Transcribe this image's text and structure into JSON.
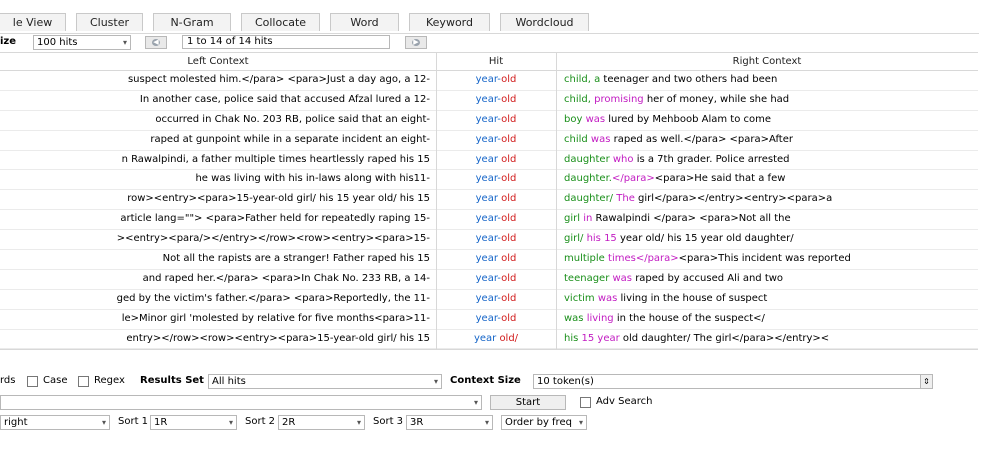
{
  "tabs": [
    "le View",
    "Cluster",
    "N-Gram",
    "Collocate",
    "Word",
    "Keyword",
    "Wordcloud"
  ],
  "pager": {
    "size_label": "ize",
    "hits_per_page": "100 hits",
    "range": "1 to 14 of 14 hits"
  },
  "table": {
    "headers": [
      "Left Context",
      "Hit",
      "Right Context"
    ],
    "rows": [
      {
        "left": "suspect molested him.</para> <para>Just a day ago, a 12-",
        "hit": [
          "year-old"
        ],
        "right": [
          [
            "child, a",
            "g1"
          ],
          [
            " teenager and two others had been",
            "n"
          ]
        ]
      },
      {
        "left": "In another case, police said that accused Afzal lured a 12-",
        "hit": [
          "year-old"
        ],
        "right": [
          [
            "child,",
            "g1"
          ],
          [
            " promising",
            "g2"
          ],
          [
            " her of money, while she had",
            "n"
          ]
        ]
      },
      {
        "left": "occurred in Chak No. 203 RB, police said that an eight-",
        "hit": [
          "year-old"
        ],
        "right": [
          [
            "boy",
            "g1"
          ],
          [
            " was",
            "g2"
          ],
          [
            " lured by Mehboob Alam to come",
            "n"
          ]
        ]
      },
      {
        "left": "raped at gunpoint while in a separate incident an eight-",
        "hit": [
          "year-old"
        ],
        "right": [
          [
            "child",
            "g1"
          ],
          [
            " was",
            "g2"
          ],
          [
            " raped as well.</para> <para>After",
            "n"
          ]
        ]
      },
      {
        "left": "n Rawalpindi, a father multiple times heartlessly raped his 15",
        "hit": [
          "year old"
        ],
        "right": [
          [
            "daughter",
            "g1"
          ],
          [
            " who",
            "g2"
          ],
          [
            " is a 7th grader. Police arrested",
            "n"
          ]
        ]
      },
      {
        "left": "he was living with his in-laws along with his11-",
        "hit": [
          "year-old"
        ],
        "right": [
          [
            "daughter.",
            "g1"
          ],
          [
            "</para>",
            "g2"
          ],
          [
            "<para>He said that a few",
            "n"
          ]
        ]
      },
      {
        "left": "row><entry><para>15-year-old girl/  his 15 year old/ his 15",
        "hit": [
          "year old"
        ],
        "right": [
          [
            "daughter/",
            "g1"
          ],
          [
            " The",
            "g2"
          ],
          [
            " girl</para></entry><entry><para>a",
            "n"
          ]
        ]
      },
      {
        "left": "article lang=\"\"> <para>Father held for repeatedly raping 15-",
        "hit": [
          "year-old"
        ],
        "right": [
          [
            "girl",
            "g1"
          ],
          [
            " in",
            "g2"
          ],
          [
            " Rawalpindi </para> <para>Not all the",
            "n"
          ]
        ]
      },
      {
        "left": "><entry><para/></entry></row><row><entry><para>15-",
        "hit": [
          "year-old"
        ],
        "right": [
          [
            "girl/",
            "g1"
          ],
          [
            "  his 15",
            "g2"
          ],
          [
            " year old/ his 15 year old daughter/",
            "n"
          ]
        ]
      },
      {
        "left": "Not all the rapists are a stranger! Father raped  his 15",
        "hit": [
          "year old"
        ],
        "right": [
          [
            "multiple",
            "g1"
          ],
          [
            " times</para>",
            "g2"
          ],
          [
            "<para>This incident was reported",
            "n"
          ]
        ]
      },
      {
        "left": "and raped her.</para> <para>In Chak No. 233 RB, a 14-",
        "hit": [
          "year-old"
        ],
        "right": [
          [
            "teenager",
            "g1"
          ],
          [
            " was",
            "g2"
          ],
          [
            " raped by accused Ali and two",
            "n"
          ]
        ]
      },
      {
        "left": "ged by the victim's father.</para> <para>Reportedly, the 11-",
        "hit": [
          "year-old"
        ],
        "right": [
          [
            "victim",
            "g1"
          ],
          [
            " was",
            "g2"
          ],
          [
            " living in the house of suspect",
            "n"
          ]
        ]
      },
      {
        "left": "le>Minor girl 'molested by relative for five months<para>11-",
        "hit": [
          "year-old"
        ],
        "right": [
          [
            "was",
            "g1"
          ],
          [
            " living",
            "g2"
          ],
          [
            " in the house of the suspect</",
            "n"
          ]
        ]
      },
      {
        "left": "entry></row><row><entry><para>15-year-old girl/  his 15",
        "hit": [
          "year old/"
        ],
        "right": [
          [
            "his",
            "g1"
          ],
          [
            " 15",
            "g2"
          ],
          [
            " year",
            "g2"
          ],
          [
            " old daughter/ The girl</para></entry><",
            "n"
          ]
        ]
      }
    ]
  },
  "search_options": {
    "words_label": "rds",
    "case_label": "Case",
    "regex_label": "Regex",
    "results_set_label": "Results Set",
    "results_set_value": "All hits",
    "context_size_label": "Context Size",
    "context_size_value": "10 token(s)"
  },
  "search_row": {
    "start_label": "Start",
    "adv_search_label": "Adv Search"
  },
  "sort_row": {
    "position_value": "right",
    "sort1_label": "Sort 1",
    "sort1_value": "1R",
    "sort2_label": "Sort 2",
    "sort2_value": "2R",
    "sort3_label": "Sort 3",
    "sort3_value": "3R",
    "order_value": "Order by freq"
  }
}
